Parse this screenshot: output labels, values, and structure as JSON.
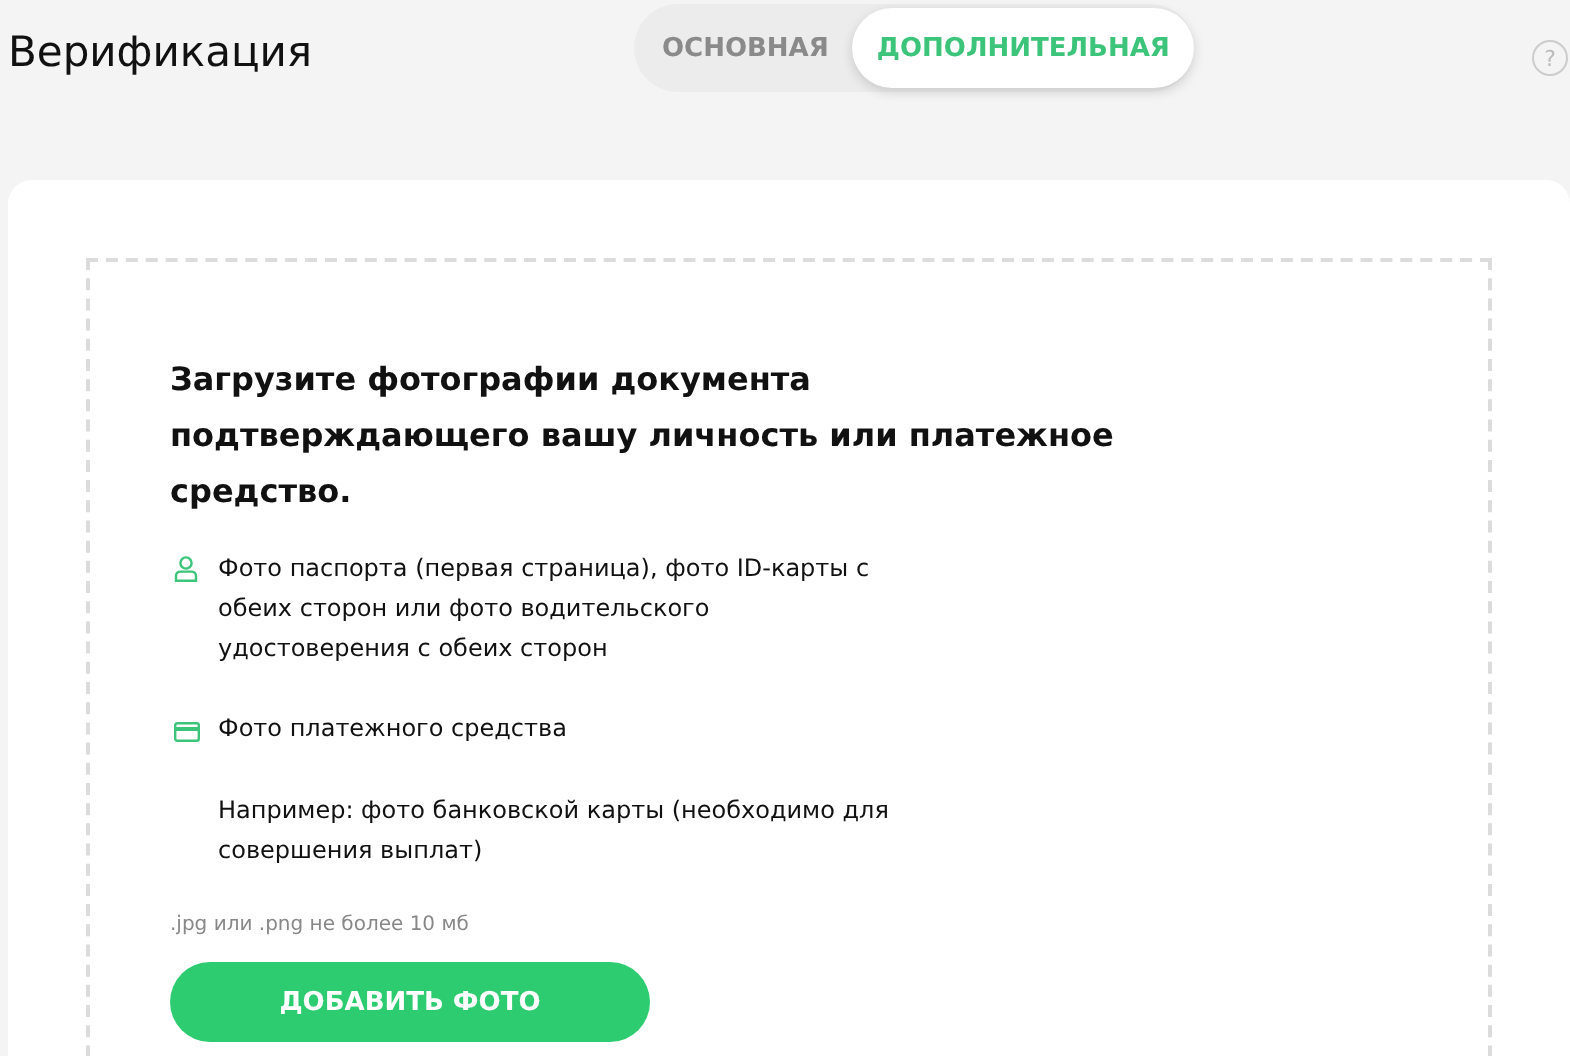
{
  "header": {
    "title": "Верификация",
    "help": "?"
  },
  "tabs": [
    {
      "label": "ОСНОВНАЯ",
      "selected": false
    },
    {
      "label": "ДОПОЛНИТЕЛЬНАЯ",
      "selected": true
    }
  ],
  "upload": {
    "heading": "Загрузите фотографии документа подтверждающего вашу личность или платежное средство.",
    "items": [
      {
        "kind": "person",
        "text": "Фото паспорта (первая страница), фото ID-карты с обеих сторон или фото водительского удостоверения с обеих сторон"
      },
      {
        "kind": "card",
        "text": "Фото платежного средства"
      },
      {
        "kind": "note",
        "text": "Например: фото банковской карты (необходимо для совершения выплат)"
      }
    ],
    "hint": ".jpg или .png не более 10 мб",
    "button": "ДОБАВИТЬ ФОТО"
  }
}
